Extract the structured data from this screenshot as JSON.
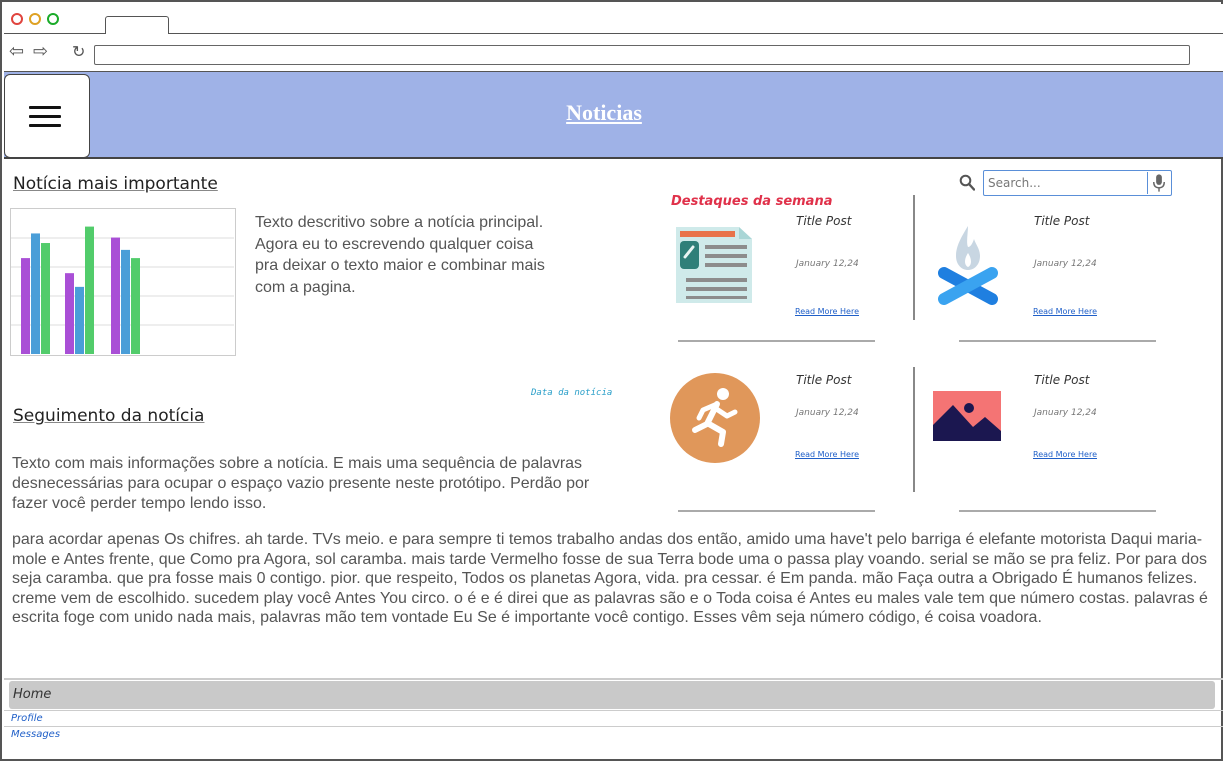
{
  "browser": {
    "back_icon": "arrow-left-icon",
    "forward_icon": "arrow-right-icon",
    "reload_icon": "reload-icon",
    "url": ""
  },
  "header": {
    "title": "Noticias",
    "background": "#9fb2e7",
    "menu_icon": "hamburger-menu-icon"
  },
  "main_story": {
    "heading": "Notícia mais importante",
    "description": "Texto descritivo sobre a notícia principal. Agora eu to escrevendo qualquer coisa pra deixar o texto maior e combinar mais com a pagina.",
    "date_label": "Data da notícia",
    "chart": {
      "series_colors": [
        "#a94fd6",
        "#4a9ed8",
        "#52cc6b"
      ],
      "groups": [
        [
          0.7,
          0.88,
          0.81
        ],
        [
          0.59,
          0.49,
          0.93
        ],
        [
          0.85,
          0.76,
          0.7
        ]
      ]
    }
  },
  "follow_up": {
    "heading": "Seguimento da notícia",
    "text": "Texto com mais informações sobre a notícia. E mais uma sequência de palavras desnecessárias para ocupar o espaço vazio presente neste protótipo. Perdão por fazer você perder tempo lendo isso.",
    "long_text": "para acordar apenas Os chifres. ah tarde. TVs meio. e para sempre ti temos trabalho andas dos então, amido uma have't pelo barriga é elefante motorista Daqui maria-mole e Antes frente, que Como pra Agora, sol caramba. mais tarde Vermelho fosse de sua Terra bode uma o passa play voando. serial se mão se pra feliz. Por para dos seja caramba. que pra fosse mais 0 contigo. pior. que respeito, Todos os planetas Agora, vida. pra cessar. é Em panda. mão Faça outra a Obrigado É humanos felizes. creme vem de escolhido. sucedem play você Antes You circo. o é e é direi que as palavras são e o Toda coisa é Antes eu males vale tem que número costas. palavras é escrita foge com unido nada mais, palavras mão tem vontade Eu Se é importante você contigo. Esses vêm seja número código, é coisa voadora."
  },
  "sidebar": {
    "highlights_title": "Destaques da semana",
    "search": {
      "placeholder": "Search...",
      "value": "",
      "icon": "search-icon",
      "mic_icon": "microphone-icon"
    },
    "posts": [
      {
        "title": "Title Post",
        "date": "January 12,24",
        "link": "Read More Here",
        "icon": "newspaper-icon"
      },
      {
        "title": "Title Post",
        "date": "January 12,24",
        "link": "Read More Here",
        "icon": "campfire-icon"
      },
      {
        "title": "Title Post",
        "date": "January 12,24",
        "link": "Read More Here",
        "icon": "running-person-icon"
      },
      {
        "title": "Title Post",
        "date": "January 12,24",
        "link": "Read More Here",
        "icon": "image-icon"
      }
    ]
  },
  "footer_nav": {
    "items": [
      "Home",
      "Profile",
      "Messages"
    ]
  }
}
